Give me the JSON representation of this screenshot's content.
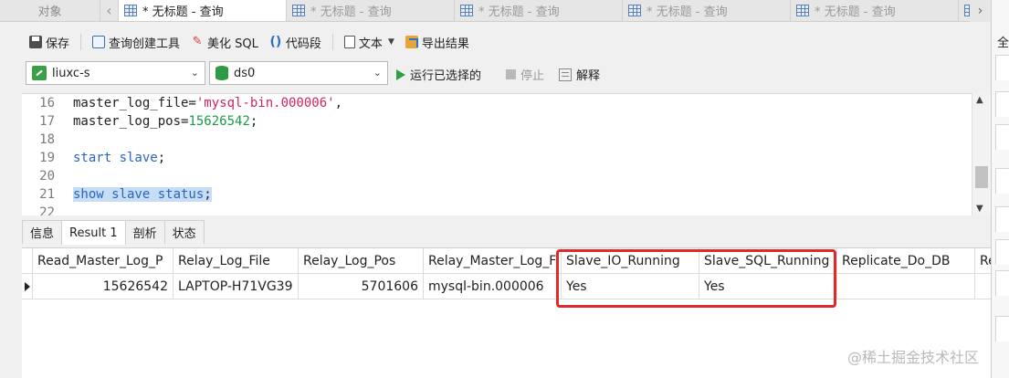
{
  "tabs": {
    "objects_label": "对象",
    "query_tabs": [
      {
        "label": "* 无标题 - 查询",
        "active": true
      },
      {
        "label": "* 无标题 - 查询",
        "active": false
      },
      {
        "label": "* 无标题 - 查询",
        "active": false
      },
      {
        "label": "* 无标题 - 查询",
        "active": false
      },
      {
        "label": "* 无标题 - 查询",
        "active": false
      }
    ]
  },
  "toolbar": {
    "save_label": "保存",
    "query_builder_label": "查询创建工具",
    "beautify_label": "美化 SQL",
    "snippet_label": "代码段",
    "text_label": "文本",
    "export_label": "导出结果"
  },
  "connection": {
    "conn_value": "liuxc-s",
    "db_value": "ds0",
    "run_selected_label": "运行已选择的",
    "stop_label": "停止",
    "explain_label": "解释"
  },
  "editor": {
    "lines": [
      {
        "n": "16",
        "segments": [
          {
            "t": "plain",
            "v": "master_log_file="
          },
          {
            "t": "str",
            "v": "'mysql-bin.000006'"
          },
          {
            "t": "plain",
            "v": ","
          }
        ]
      },
      {
        "n": "17",
        "segments": [
          {
            "t": "plain",
            "v": "master_log_pos="
          },
          {
            "t": "num",
            "v": "15626542"
          },
          {
            "t": "plain",
            "v": ";"
          }
        ]
      },
      {
        "n": "18",
        "segments": []
      },
      {
        "n": "19",
        "segments": [
          {
            "t": "kw",
            "v": "start slave"
          },
          {
            "t": "plain",
            "v": ";"
          }
        ]
      },
      {
        "n": "20",
        "segments": []
      },
      {
        "n": "21",
        "segments": [
          {
            "t": "kwsel",
            "v": "show slave status"
          },
          {
            "t": "sel",
            "v": ";"
          }
        ]
      },
      {
        "n": "22",
        "segments": []
      }
    ]
  },
  "result_tabs": [
    "信息",
    "Result 1",
    "剖析",
    "状态"
  ],
  "result_active_index": 1,
  "grid": {
    "columns": [
      "Read_Master_Log_P",
      "Relay_Log_File",
      "Relay_Log_Pos",
      "Relay_Master_Log_F",
      "Slave_IO_Running",
      "Slave_SQL_Running",
      "Replicate_Do_DB",
      "Re"
    ],
    "rows": [
      [
        "15626542",
        "LAPTOP-H71VG39",
        "5701606",
        "mysql-bin.000006",
        "Yes",
        "Yes",
        "",
        ""
      ]
    ]
  },
  "right_panel": {
    "top_char": "全"
  },
  "watermark": "@稀土掘金技术社区",
  "colors": {
    "highlight_box": "#e02a2a",
    "selection": "#c7dcf5",
    "keyword": "#2a64c0",
    "string": "#d1245e",
    "number": "#1a9a49"
  }
}
